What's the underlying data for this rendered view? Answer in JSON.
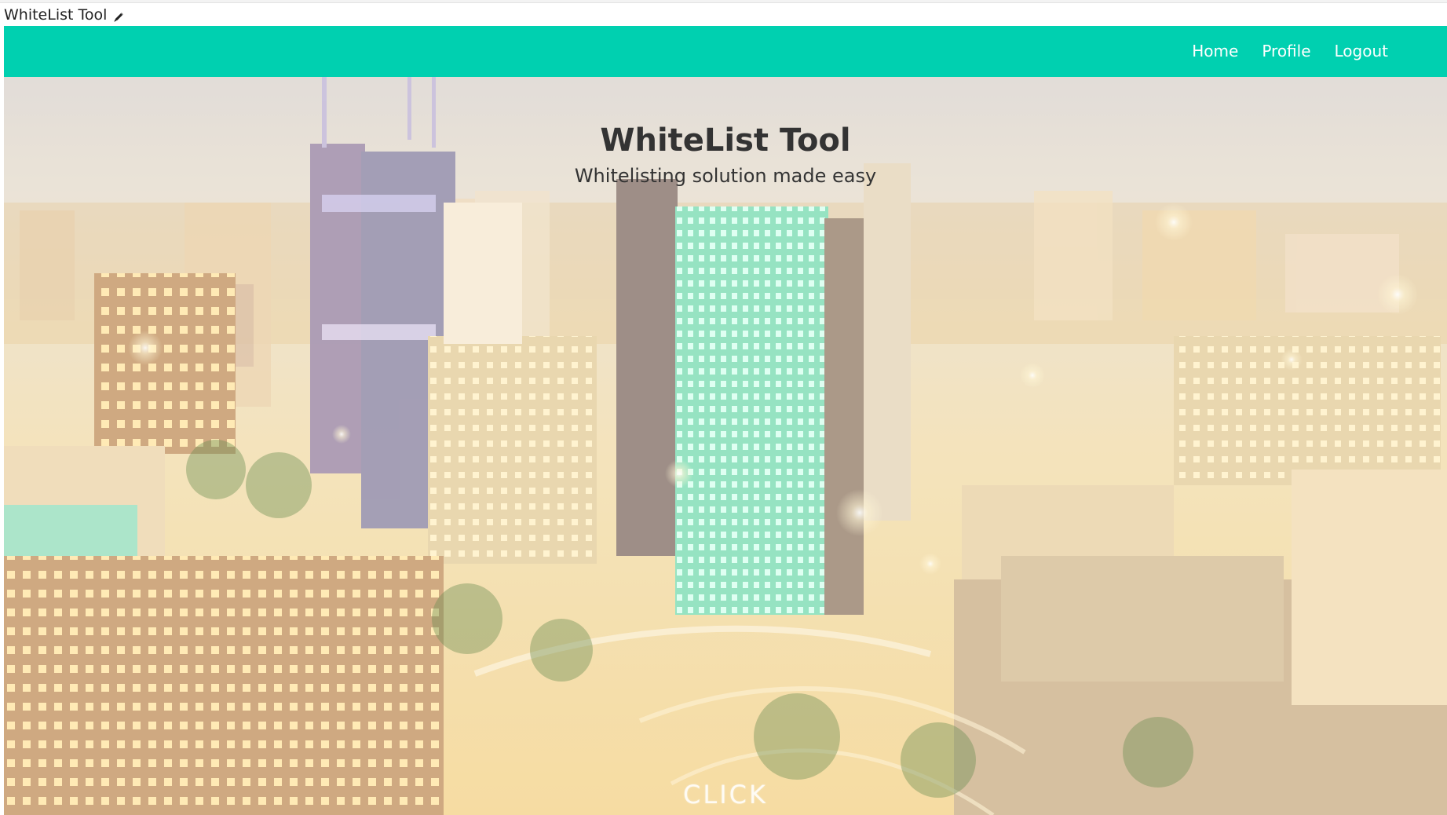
{
  "app": {
    "title": "WhiteList Tool",
    "title_icon": "pencil-icon"
  },
  "nav": {
    "links": [
      "Home",
      "Profile",
      "Logout"
    ]
  },
  "hero": {
    "title": "WhiteList Tool",
    "subtitle": "Whitelisting solution made easy",
    "cta": "CLICK"
  },
  "colors": {
    "navbar": "#00d0b0",
    "nav_text": "#ffffff",
    "heading_text": "#333333",
    "hero_overlay": "#f2dca8"
  }
}
